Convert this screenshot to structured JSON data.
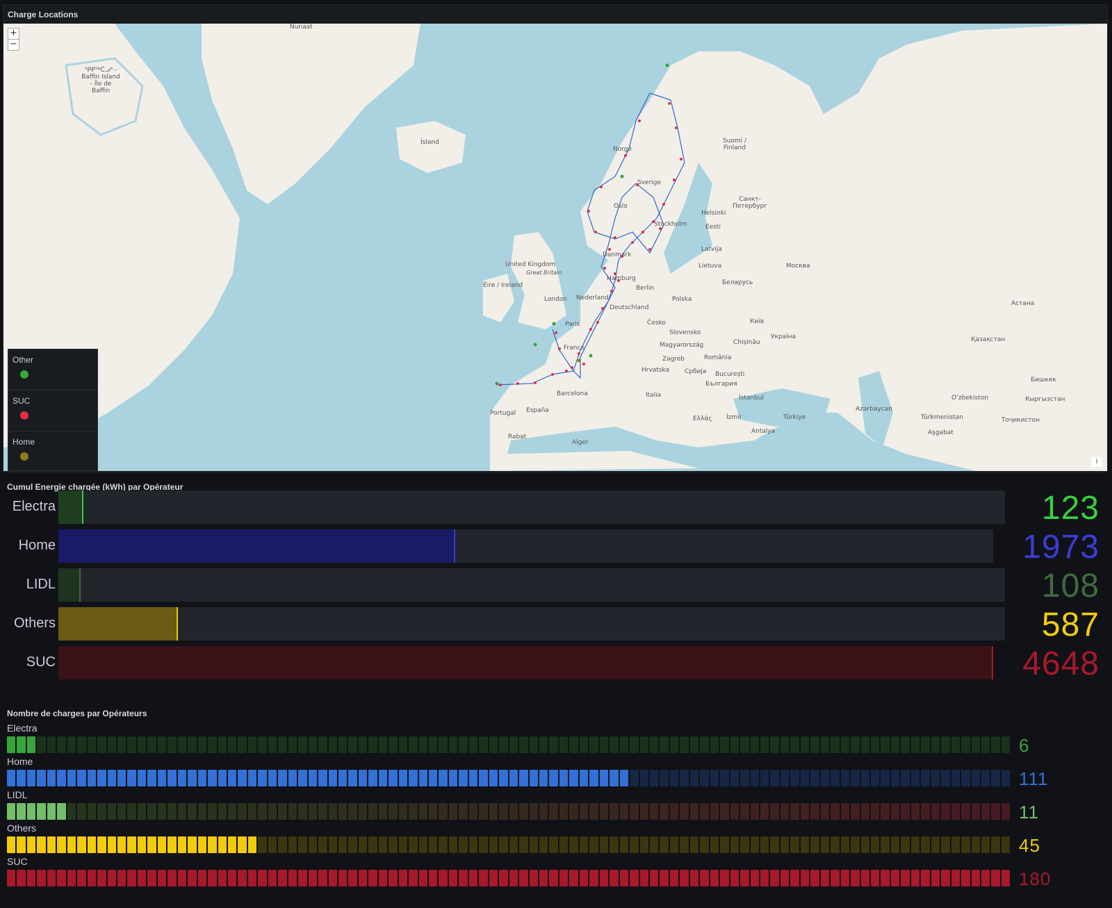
{
  "map_panel": {
    "title": "Charge Locations",
    "zoom_in": "+",
    "zoom_out": "−",
    "attribution": "i",
    "legend": [
      {
        "label": "Other",
        "color": "#37a53b"
      },
      {
        "label": "SUC",
        "color": "#e02f44"
      },
      {
        "label": "Home",
        "color": "#8a7b1d"
      }
    ],
    "labels": [
      {
        "text": "Nunaat"
      },
      {
        "text": "ᕿᑭᖅᑖᓗᒃ - Baffin Island - Île de Baffin"
      },
      {
        "text": "Ísland"
      },
      {
        "text": "Norge"
      },
      {
        "text": "Sverige"
      },
      {
        "text": "Suomi / Finland"
      },
      {
        "text": "Oslo"
      },
      {
        "text": "Stockholm"
      },
      {
        "text": "Helsinki"
      },
      {
        "text": "Санкт-Петербург"
      },
      {
        "text": "Eesti"
      },
      {
        "text": "Latvija"
      },
      {
        "text": "Lietuva"
      },
      {
        "text": "Москва"
      },
      {
        "text": "United Kingdom"
      },
      {
        "text": "Great Britain"
      },
      {
        "text": "Éire / Ireland"
      },
      {
        "text": "London"
      },
      {
        "text": "Nederland"
      },
      {
        "text": "Danmark"
      },
      {
        "text": "Hamburg"
      },
      {
        "text": "Berlin"
      },
      {
        "text": "Беларусь"
      },
      {
        "text": "Polska"
      },
      {
        "text": "Deutschland"
      },
      {
        "text": "Paris"
      },
      {
        "text": "France"
      },
      {
        "text": "Česko"
      },
      {
        "text": "Slovensko"
      },
      {
        "text": "Magyarország"
      },
      {
        "text": "Україна"
      },
      {
        "text": "Київ"
      },
      {
        "text": "Chișinău"
      },
      {
        "text": "România"
      },
      {
        "text": "Zagreb"
      },
      {
        "text": "Hrvatska"
      },
      {
        "text": "Србија"
      },
      {
        "text": "București"
      },
      {
        "text": "България"
      },
      {
        "text": "Barcelona"
      },
      {
        "text": "España"
      },
      {
        "text": "Portugal"
      },
      {
        "text": "Italia"
      },
      {
        "text": "İstanbul"
      },
      {
        "text": "Ελλάς"
      },
      {
        "text": "İzmir"
      },
      {
        "text": "Türkiye"
      },
      {
        "text": "Antalya"
      },
      {
        "text": "Rabat"
      },
      {
        "text": "Alger"
      },
      {
        "text": "Астана"
      },
      {
        "text": "Қазақстан"
      },
      {
        "text": "Бишкек"
      },
      {
        "text": "Oʻzbekiston"
      },
      {
        "text": "Türkmenistan"
      },
      {
        "text": "Aşgabat"
      },
      {
        "text": "Azərbaycan"
      },
      {
        "text": "Тоҷикистон"
      },
      {
        "text": "Кыргызстан"
      }
    ]
  },
  "energy_panel": {
    "title": "Cumul Energie chargée (kWh) par Opérateur",
    "max": 4648,
    "rows": [
      {
        "label": "Electra",
        "value": 123,
        "display": "123",
        "fill": "#1f3d1f",
        "edge": "#37d03b",
        "text": "#37d03b"
      },
      {
        "label": "Home",
        "value": 1973,
        "display": "1973",
        "fill": "#1a1a66",
        "edge": "#3c3cd6",
        "text": "#3c3cd6"
      },
      {
        "label": "LIDL",
        "value": 108,
        "display": "108",
        "fill": "#1e3320",
        "edge": "#3f6b3f",
        "text": "#3f6b3f"
      },
      {
        "label": "Others",
        "value": 587,
        "display": "587",
        "fill": "#6b5a14",
        "edge": "#f2cc0c",
        "text": "#f2cc0c"
      },
      {
        "label": "SUC",
        "value": 4648,
        "display": "4648",
        "fill": "#3a1218",
        "edge": "#a8192b",
        "text": "#a8192b"
      }
    ]
  },
  "count_panel": {
    "title": "Nombre de charges par Opérateurs",
    "max": 180,
    "rows": [
      {
        "label": "Electra",
        "value": 6,
        "display": "6",
        "on": "#37a53b",
        "off": "#18321b",
        "text": "#37a53b"
      },
      {
        "label": "Home",
        "value": 111,
        "display": "111",
        "on": "#3271d6",
        "off": "#162746",
        "text": "#3271d6"
      },
      {
        "label": "LIDL",
        "value": 11,
        "display": "11",
        "on": "#73bf69",
        "off": "gradient-lidl",
        "text": "#73bf69"
      },
      {
        "label": "Others",
        "value": 45,
        "display": "45",
        "on": "#f2cc0c",
        "off": "#3b3510",
        "text": "#f2cc0c"
      },
      {
        "label": "SUC",
        "value": 180,
        "display": "180",
        "on": "#a8192b",
        "off": "#3a1218",
        "text": "#a8192b"
      }
    ]
  }
}
